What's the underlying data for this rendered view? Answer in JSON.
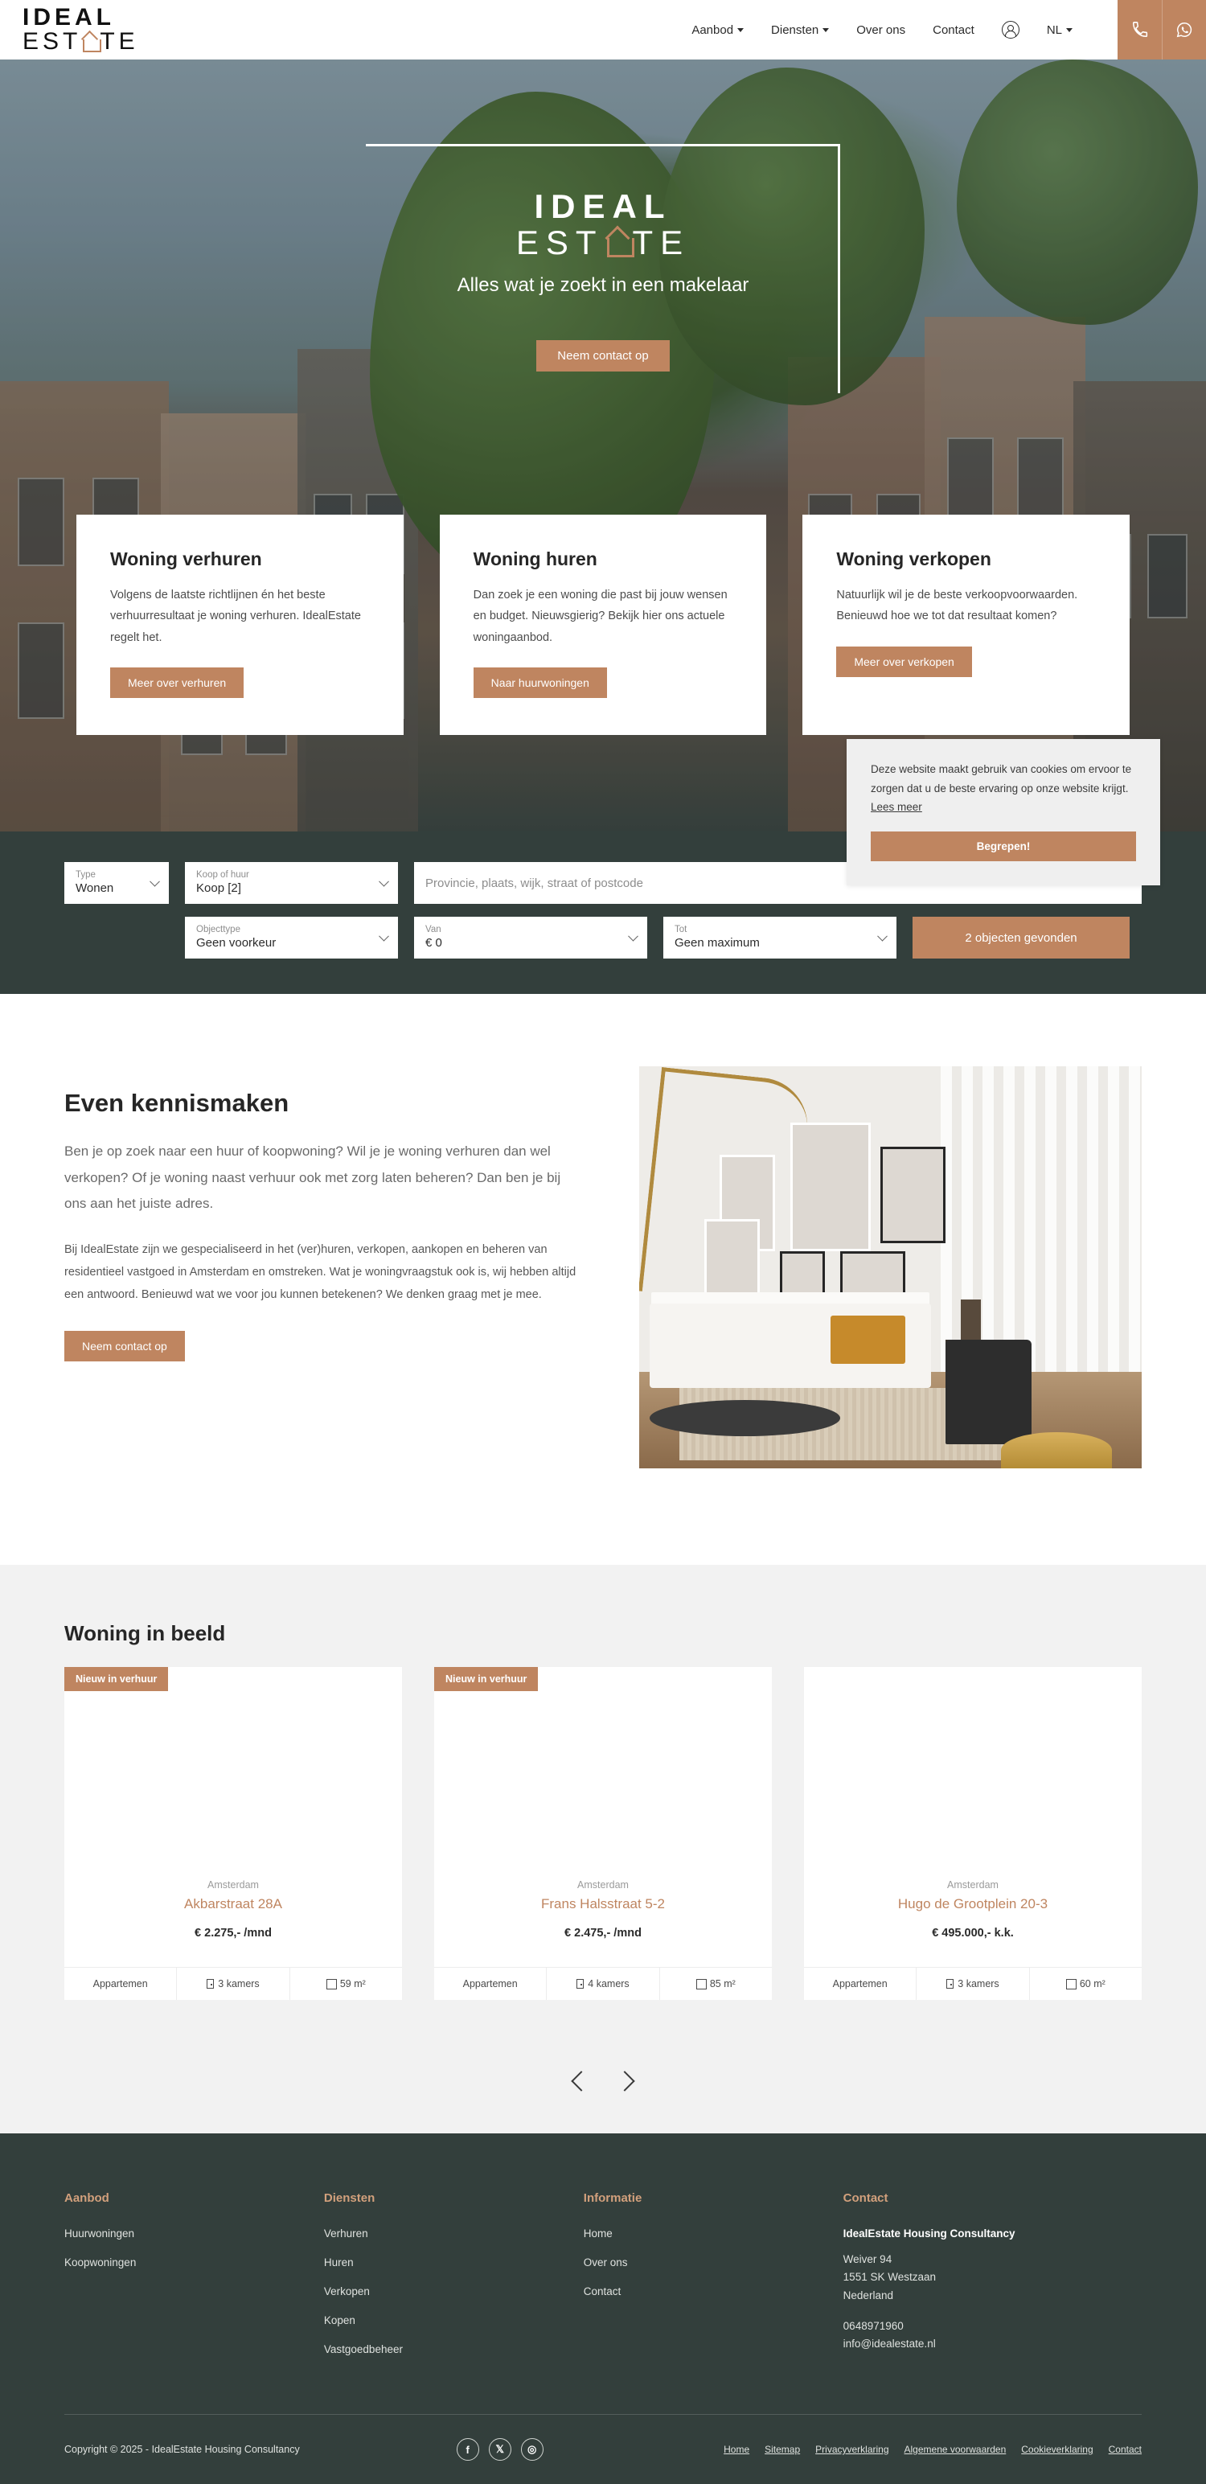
{
  "brand": {
    "name_line1": "IDEAL",
    "name_line2_a": "EST",
    "name_line2_b": "TE"
  },
  "header": {
    "nav": [
      {
        "label": "Aanbod",
        "has_caret": true
      },
      {
        "label": "Diensten",
        "has_caret": true
      },
      {
        "label": "Over ons",
        "has_caret": false
      },
      {
        "label": "Contact",
        "has_caret": false
      }
    ],
    "account_icon": "user-circle-icon",
    "language": "NL",
    "phone_icon": "phone-icon",
    "whatsapp_icon": "whatsapp-icon"
  },
  "hero": {
    "logo_line1": "IDEAL",
    "logo_line2_a": "EST",
    "logo_line2_b": "TE",
    "tagline": "Alles wat je zoekt in een makelaar",
    "cta": "Neem contact op"
  },
  "info_cards": [
    {
      "title": "Woning verhuren",
      "body": "Volgens de laatste richtlijnen én het beste verhuurresultaat je woning verhuren. IdealEstate regelt het.",
      "button": "Meer over verhuren"
    },
    {
      "title": "Woning huren",
      "body": "Dan zoek je een woning die past bij jouw wensen en budget. Nieuwsgierig? Bekijk hier ons actuele woningaanbod.",
      "button": "Naar huurwoningen"
    },
    {
      "title": "Woning verkopen",
      "body": "Natuurlijk wil je de beste verkoopvoorwaarden. Benieuwd hoe we tot dat resultaat komen?",
      "button": "Meer over verkopen"
    }
  ],
  "search": {
    "type": {
      "label": "Type",
      "value": "Wonen"
    },
    "koop_of_huur": {
      "label": "Koop of huur",
      "value": "Koop [2]"
    },
    "location": {
      "placeholder": "Provincie, plaats, wijk, straat of postcode",
      "value": ""
    },
    "objecttype": {
      "label": "Objecttype",
      "value": "Geen voorkeur"
    },
    "van": {
      "label": "Van",
      "value": "€ 0"
    },
    "tot": {
      "label": "Tot",
      "value": "Geen maximum"
    },
    "submit": "2 objecten gevonden"
  },
  "cookie": {
    "text": "Deze website maakt gebruik van cookies om ervoor te zorgen dat u de beste ervaring op onze website krijgt.",
    "link": "Lees meer",
    "button": "Begrepen!"
  },
  "about": {
    "heading": "Even kennismaken",
    "lead": "Ben je op zoek naar een huur of koopwoning? Wil je je woning verhuren dan wel verkopen? Of je woning naast verhuur ook met zorg laten beheren? Dan ben je bij ons aan het juiste adres.",
    "body": "Bij IdealEstate zijn we gespecialiseerd in het (ver)huren, verkopen, aankopen en beheren van residentieel vastgoed in Amsterdam en omstreken. Wat je woningvraagstuk ook is, wij hebben altijd een antwoord. Benieuwd wat we voor jou kunnen betekenen? We denken graag met je mee.",
    "button": "Neem contact op",
    "image_alt": "living-room-photo"
  },
  "featured": {
    "heading": "Woning in beeld",
    "properties": [
      {
        "badge": "Nieuw in verhuur",
        "city": "Amsterdam",
        "title": "Akbarstraat 28A",
        "price": "€ 2.275,- /mnd",
        "type": "Appartemen",
        "rooms": "3 kamers",
        "area": "59 m²"
      },
      {
        "badge": "Nieuw in verhuur",
        "city": "Amsterdam",
        "title": "Frans Halsstraat 5-2",
        "price": "€ 2.475,- /mnd",
        "type": "Appartemen",
        "rooms": "4 kamers",
        "area": "85 m²"
      },
      {
        "badge": "",
        "city": "Amsterdam",
        "title": "Hugo de Grootplein 20-3",
        "price": "€ 495.000,- k.k.",
        "type": "Appartemen",
        "rooms": "3 kamers",
        "area": "60 m²"
      }
    ],
    "prev_label": "chevron-left-icon",
    "next_label": "chevron-right-icon"
  },
  "footer": {
    "columns": [
      {
        "heading": "Aanbod",
        "links": [
          "Huurwoningen",
          "Koopwoningen"
        ]
      },
      {
        "heading": "Diensten",
        "links": [
          "Verhuren",
          "Huren",
          "Verkopen",
          "Kopen",
          "Vastgoedbeheer"
        ]
      },
      {
        "heading": "Informatie",
        "links": [
          "Home",
          "Over ons",
          "Contact"
        ]
      }
    ],
    "contact": {
      "heading": "Contact",
      "company": "IdealEstate Housing Consultancy",
      "address1": "Weiver 94",
      "address2": "1551 SK Westzaan",
      "country": "Nederland",
      "phone": "0648971960",
      "email": "info@idealestate.nl"
    },
    "copyright": "Copyright © 2025 - IdealEstate Housing Consultancy",
    "socials": [
      {
        "name": "facebook-icon",
        "glyph": "f"
      },
      {
        "name": "x-twitter-icon",
        "glyph": "𝕏"
      },
      {
        "name": "instagram-icon",
        "glyph": "◎"
      }
    ],
    "legal": [
      "Home",
      "Sitemap",
      "Privacyverklaring",
      "Algemene voorwaarden",
      "Cookieverklaring",
      "Contact"
    ]
  },
  "colors": {
    "accent": "#bf8560",
    "dark": "#333f3c",
    "light_gray": "#f2f2f2"
  }
}
